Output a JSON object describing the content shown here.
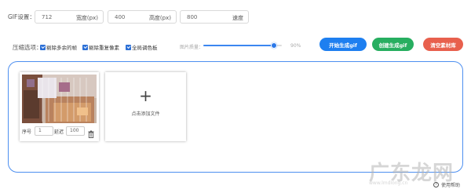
{
  "gif_settings": {
    "label": "GIF设置：",
    "width": {
      "value": "712",
      "unit": "宽度(px)"
    },
    "height": {
      "value": "400",
      "unit": "高度(px)"
    },
    "speed": {
      "value": "800",
      "unit": "速度"
    }
  },
  "compress": {
    "label": "压缩选项：",
    "options": [
      {
        "label": "剔除多余的帧",
        "checked": true
      },
      {
        "label": "剔除重复像素",
        "checked": true
      },
      {
        "label": "全局调色板",
        "checked": true
      }
    ],
    "quality_label": "图片质量：",
    "quality_value": "90%",
    "quality_fraction": 0.9
  },
  "buttons": {
    "start": {
      "label": "开始生成gif",
      "color": "#1e7ff0"
    },
    "create": {
      "label": "创建生成gif",
      "color": "#27ae60"
    },
    "clear": {
      "label": "清空素材库",
      "color": "#e8604d"
    }
  },
  "card": {
    "seq_label": "序号",
    "seq_value": "1",
    "delay_label": "延迟",
    "delay_value": "100"
  },
  "add_file": {
    "plus": "+",
    "label": "点击添加文件"
  },
  "help": {
    "label": "使用帮助"
  },
  "watermark": {
    "text": "广东龙网",
    "url": "www.lmdlong.cn"
  }
}
